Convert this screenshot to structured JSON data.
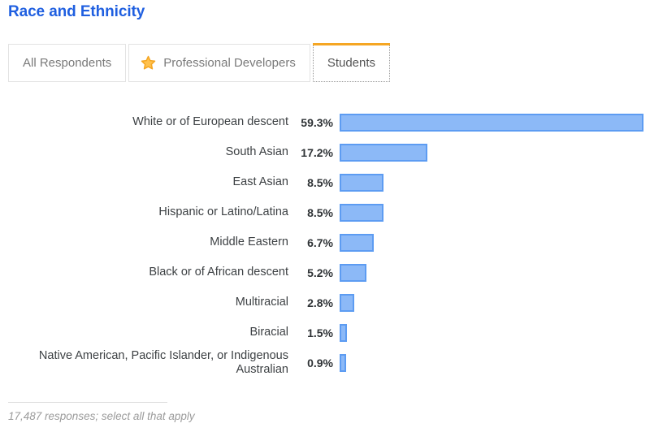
{
  "title": "Race and Ethnicity",
  "colors": {
    "title": "#1f5fe0",
    "bar_fill": "#8cb9f7",
    "bar_border": "#5d9cf2",
    "active_tab_accent": "#f5a623",
    "star": "#f5a623",
    "label_text": "#3d4144",
    "footer_text": "#9b9b9b"
  },
  "tabs": [
    {
      "label": "All Respondents",
      "active": false,
      "icon": null
    },
    {
      "label": "Professional Developers",
      "active": false,
      "icon": "star-icon"
    },
    {
      "label": "Students",
      "active": true,
      "icon": null
    }
  ],
  "footer": {
    "note": "17,487 responses; select all that apply"
  },
  "chart_data": {
    "type": "bar",
    "orientation": "horizontal",
    "title": "Race and Ethnicity",
    "xlabel": "",
    "ylabel": "",
    "xlim": [
      0,
      59.3
    ],
    "grid": false,
    "legend": false,
    "value_suffix": "%",
    "categories": [
      "White or of European descent",
      "South Asian",
      "East Asian",
      "Hispanic or Latino/Latina",
      "Middle Eastern",
      "Black or of African descent",
      "Multiracial",
      "Biracial",
      "Native American, Pacific Islander, or Indigenous Australian"
    ],
    "values": [
      59.3,
      17.2,
      8.5,
      8.5,
      6.7,
      5.2,
      2.8,
      1.5,
      0.9
    ],
    "value_labels": [
      "59.3%",
      "17.2%",
      "8.5%",
      "8.5%",
      "6.7%",
      "5.2%",
      "2.8%",
      "1.5%",
      "0.9%"
    ],
    "responses": "17,487 responses; select all that apply"
  }
}
